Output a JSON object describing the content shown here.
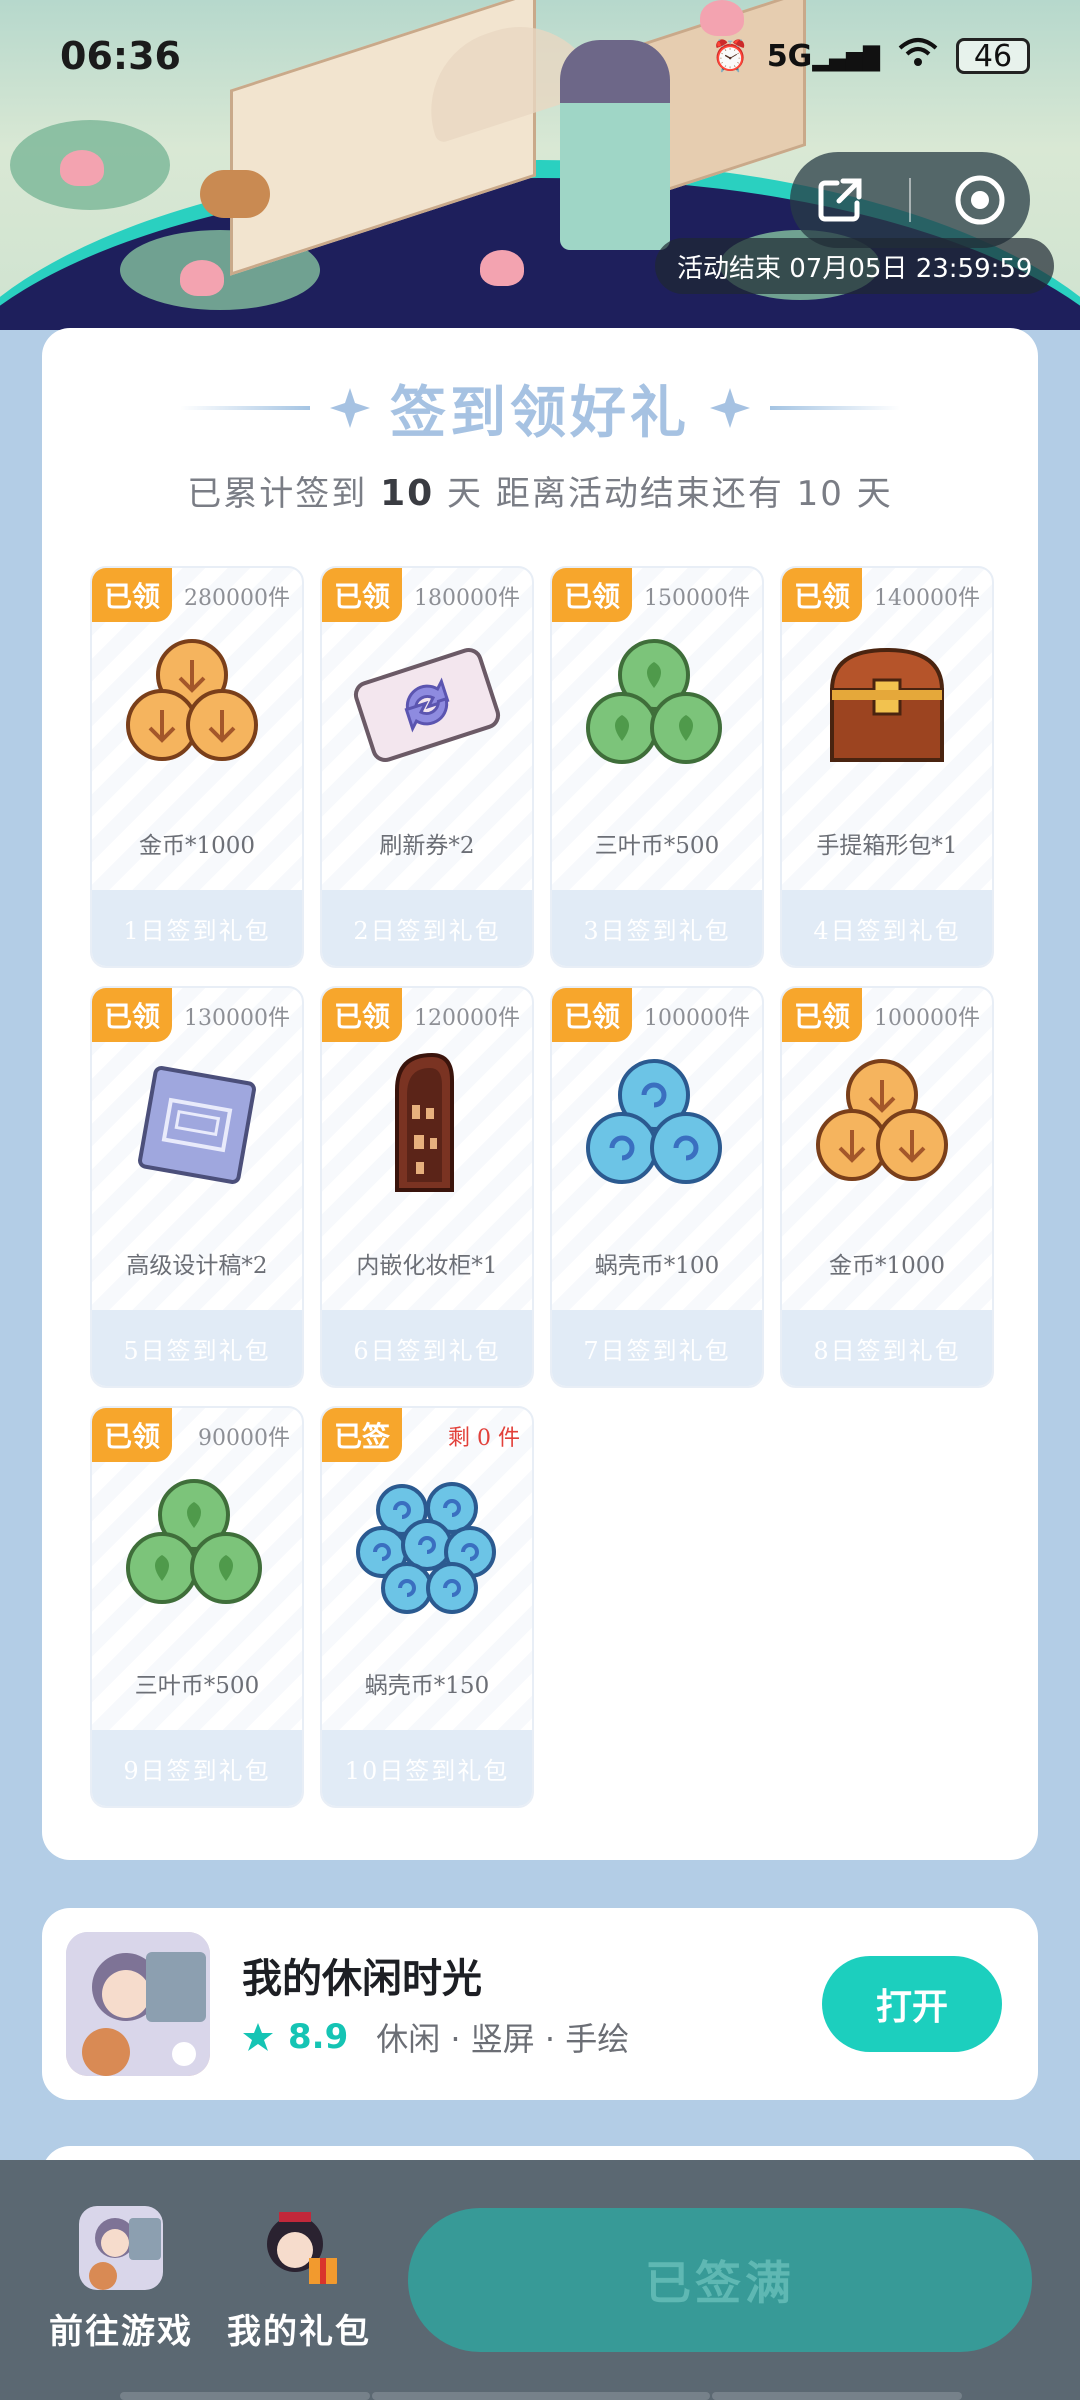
{
  "status_bar": {
    "time": "06:36",
    "network": "5G",
    "battery": "46"
  },
  "hero": {
    "activity_end": "活动结束 07月05日 23:59:59"
  },
  "signin": {
    "title": "签到领好礼",
    "subtitle_prefix": "已累计签到",
    "signed_days": "10",
    "subtitle_mid": "天  距离活动结束还有 10 天"
  },
  "rewards": [
    {
      "tag": "已领",
      "stock": "280000件",
      "name": "金币*1000",
      "day": "1日签到礼包",
      "icon": "gold-coin-icon"
    },
    {
      "tag": "已领",
      "stock": "180000件",
      "name": "刷新券*2",
      "day": "2日签到礼包",
      "icon": "refresh-ticket-icon"
    },
    {
      "tag": "已领",
      "stock": "150000件",
      "name": "三叶币*500",
      "day": "3日签到礼包",
      "icon": "clover-coin-icon"
    },
    {
      "tag": "已领",
      "stock": "140000件",
      "name": "手提箱形包*1",
      "day": "4日签到礼包",
      "icon": "treasure-chest-icon"
    },
    {
      "tag": "已领",
      "stock": "130000件",
      "name": "高级设计稿*2",
      "day": "5日签到礼包",
      "icon": "blueprint-icon"
    },
    {
      "tag": "已领",
      "stock": "120000件",
      "name": "内嵌化妆柜*1",
      "day": "6日签到礼包",
      "icon": "cabinet-icon"
    },
    {
      "tag": "已领",
      "stock": "100000件",
      "name": "蜗壳币*100",
      "day": "7日签到礼包",
      "icon": "shell-coin-icon"
    },
    {
      "tag": "已领",
      "stock": "100000件",
      "name": "金币*1000",
      "day": "8日签到礼包",
      "icon": "gold-coin-icon"
    },
    {
      "tag": "已领",
      "stock": "90000件",
      "name": "三叶币*500",
      "day": "9日签到礼包",
      "icon": "clover-coin-icon"
    },
    {
      "tag": "已签",
      "stock": "剩 0 件",
      "name": "蜗壳币*150",
      "day": "10日签到礼包",
      "icon": "shell-coin-icon"
    }
  ],
  "game": {
    "name": "我的休闲时光",
    "score": "8.9",
    "tags": "休闲 · 竖屏 · 手绘",
    "open_label": "打开"
  },
  "bottom_bar": {
    "go_game": "前往游戏",
    "my_gifts": "我的礼包",
    "signed_full": "已签满"
  },
  "colors": {
    "tag_orange": "#f7a62c",
    "accent_teal": "#1ccfbe",
    "title_blue": "#a6c2e2",
    "stock_red": "#e2403a"
  }
}
